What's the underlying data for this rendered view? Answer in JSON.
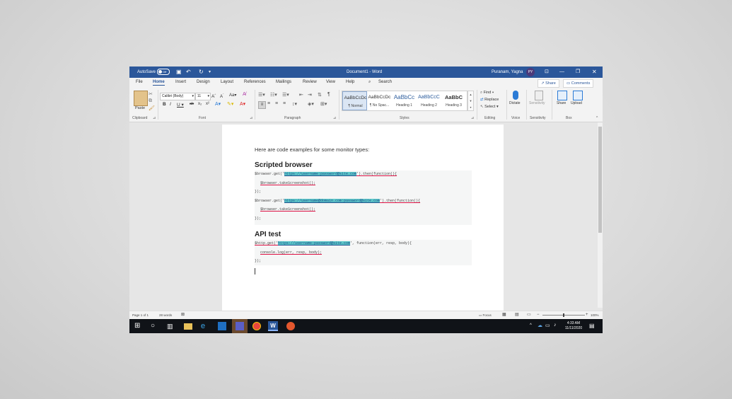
{
  "title_bar": {
    "autosave_label": "AutoSave",
    "autosave_state": "Off",
    "doc_title": "Document1  -  Word",
    "user_name": "Puranam, Yagna",
    "user_initials": "PY"
  },
  "menu": {
    "items": [
      "File",
      "Home",
      "Insert",
      "Design",
      "Layout",
      "References",
      "Mailings",
      "Review",
      "View",
      "Help"
    ],
    "search_label": "Search",
    "share_label": "Share",
    "comments_label": "Comments"
  },
  "ribbon": {
    "clipboard": {
      "paste": "Paste",
      "label": "Clipboard"
    },
    "font": {
      "name": "Calibri (Body)",
      "size": "11",
      "label": "Font"
    },
    "paragraph": {
      "label": "Paragraph"
    },
    "styles": {
      "items": [
        {
          "preview": "AaBbCcDc",
          "name": "¶ Normal"
        },
        {
          "preview": "AaBbCcDc",
          "name": "¶ No Spac..."
        },
        {
          "preview": "AaBbCc",
          "name": "Heading 1"
        },
        {
          "preview": "AaBbCcC",
          "name": "Heading 2"
        },
        {
          "preview": "AaBbC",
          "name": "Heading 3"
        }
      ],
      "label": "Styles"
    },
    "editing": {
      "find": "Find",
      "replace": "Replace",
      "select": "Select",
      "label": "Editing"
    },
    "voice": {
      "dictate": "Dictate",
      "label": "Voice"
    },
    "sensitivity": {
      "button": "Sensitivity",
      "label": "Sensitivity"
    },
    "box": {
      "share": "Share",
      "upload": "Upload",
      "label": "Box"
    }
  },
  "document": {
    "intro": "Here are code examples for some monitor types:",
    "heading1": "Scripted browser",
    "code1": {
      "l1_pre": "$browser.get('",
      "l1_url": "https://username:password@site.com",
      "l1_post": "').then(function(){",
      "l2": "$browser.takeScreenshot();",
      "l3": "});",
      "l4_pre": "$browser.get('",
      "l4_url": "https://username@domain.com:password@site.com",
      "l4_post": "').then(function(){",
      "l5": "$browser.takeScreenshot();",
      "l6": "});"
    },
    "heading2": "API test",
    "code2": {
      "l1_pre": "$http.get('",
      "l1_url": "https://username:password@site.com",
      "l1_post": "', function(err, resp, body){",
      "l2": "console.log(err, resp, body);",
      "l3": "});"
    }
  },
  "status_bar": {
    "page": "Page 1 of 1",
    "words": "28 words",
    "focus": "Focus",
    "zoom": "100%"
  },
  "taskbar": {
    "time": "4:33 AM",
    "date": "11/11/2020"
  }
}
